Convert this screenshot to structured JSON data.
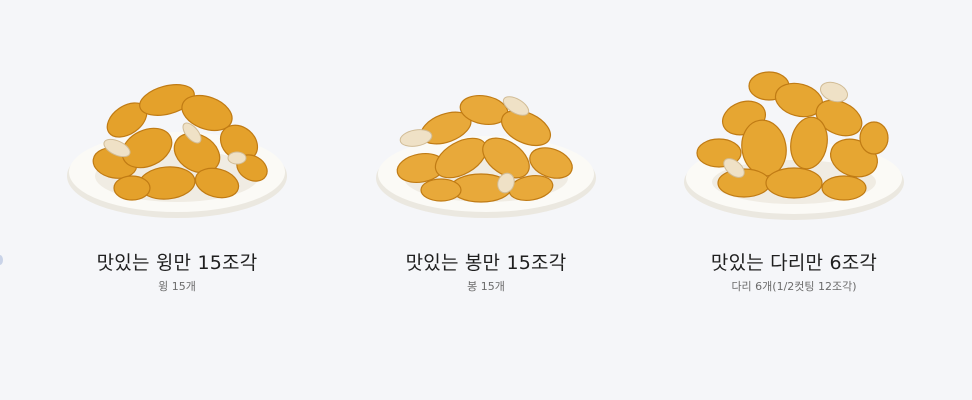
{
  "products": [
    {
      "name": "맛있는 윙만 15조각",
      "desc": "윙 15개",
      "image_icon": "chicken-wings-plate"
    },
    {
      "name": "맛있는 봉만 15조각",
      "desc": "봉 15개",
      "image_icon": "chicken-drumettes-plate"
    },
    {
      "name": "맛있는 다리만 6조각",
      "desc": "다리 6개(1/2컷팅 12조각)",
      "image_icon": "chicken-drumsticks-plate"
    }
  ],
  "colors": {
    "background": "#f5f6f9",
    "plate": "#fbfaf6",
    "chicken": "#e4a12b",
    "chicken_dark": "#c07b14",
    "garlic": "#efe1c6",
    "title_text": "#1f1f1f",
    "sub_text": "#6b6b6b"
  }
}
